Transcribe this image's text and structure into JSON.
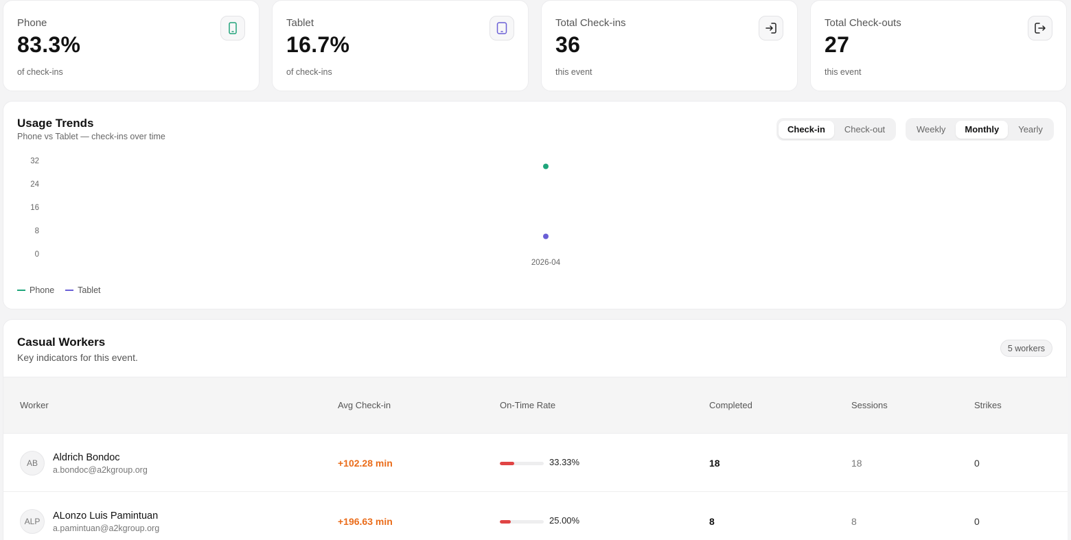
{
  "stats": [
    {
      "label": "Phone",
      "value": "83.3%",
      "sub": "of check-ins",
      "icon": "phone-icon",
      "icon_color": "#22a37a"
    },
    {
      "label": "Tablet",
      "value": "16.7%",
      "sub": "of check-ins",
      "icon": "tablet-icon",
      "icon_color": "#6a5fd6"
    },
    {
      "label": "Total Check-ins",
      "value": "36",
      "sub": "this event",
      "icon": "login-icon",
      "icon_color": "#222222"
    },
    {
      "label": "Total Check-outs",
      "value": "27",
      "sub": "this event",
      "icon": "logout-icon",
      "icon_color": "#222222"
    }
  ],
  "trends": {
    "title": "Usage Trends",
    "subtitle": "Phone vs Tablet — check-ins over time",
    "mode_toggle": [
      {
        "label": "Check-in",
        "active": true
      },
      {
        "label": "Check-out",
        "active": false
      }
    ],
    "period_toggle": [
      {
        "label": "Weekly",
        "active": false
      },
      {
        "label": "Monthly",
        "active": true
      },
      {
        "label": "Yearly",
        "active": false
      }
    ],
    "legend": [
      {
        "label": "Phone",
        "color": "#1fa57b"
      },
      {
        "label": "Tablet",
        "color": "#6a5fd6"
      }
    ]
  },
  "chart_data": {
    "type": "line",
    "title": "Usage Trends",
    "x": [
      "2026-04"
    ],
    "yticks": [
      0,
      8,
      16,
      24,
      32
    ],
    "ylim": [
      0,
      32
    ],
    "series": [
      {
        "name": "Phone",
        "values": [
          30
        ],
        "color": "#1fa57b"
      },
      {
        "name": "Tablet",
        "values": [
          6
        ],
        "color": "#6a5fd6"
      }
    ],
    "legend_position": "bottom-left",
    "grid": false
  },
  "workers": {
    "title": "Casual Workers",
    "subtitle": "Key indicators for this event.",
    "count_badge": "5 workers",
    "columns": [
      "Worker",
      "Avg Check-in",
      "On-Time Rate",
      "Completed",
      "Sessions",
      "Strikes"
    ],
    "rows": [
      {
        "initials": "AB",
        "name": "Aldrich Bondoc",
        "email": "a.bondoc@a2kgroup.org",
        "avg": "+102.28 min",
        "rate": "33.33%",
        "rate_value": 0.3333,
        "completed": "18",
        "sessions": "18",
        "strikes": "0"
      },
      {
        "initials": "ALP",
        "name": "ALonzo Luis Pamintuan",
        "email": "a.pamintuan@a2kgroup.org",
        "avg": "+196.63 min",
        "rate": "25.00%",
        "rate_value": 0.25,
        "completed": "8",
        "sessions": "8",
        "strikes": "0"
      }
    ]
  }
}
